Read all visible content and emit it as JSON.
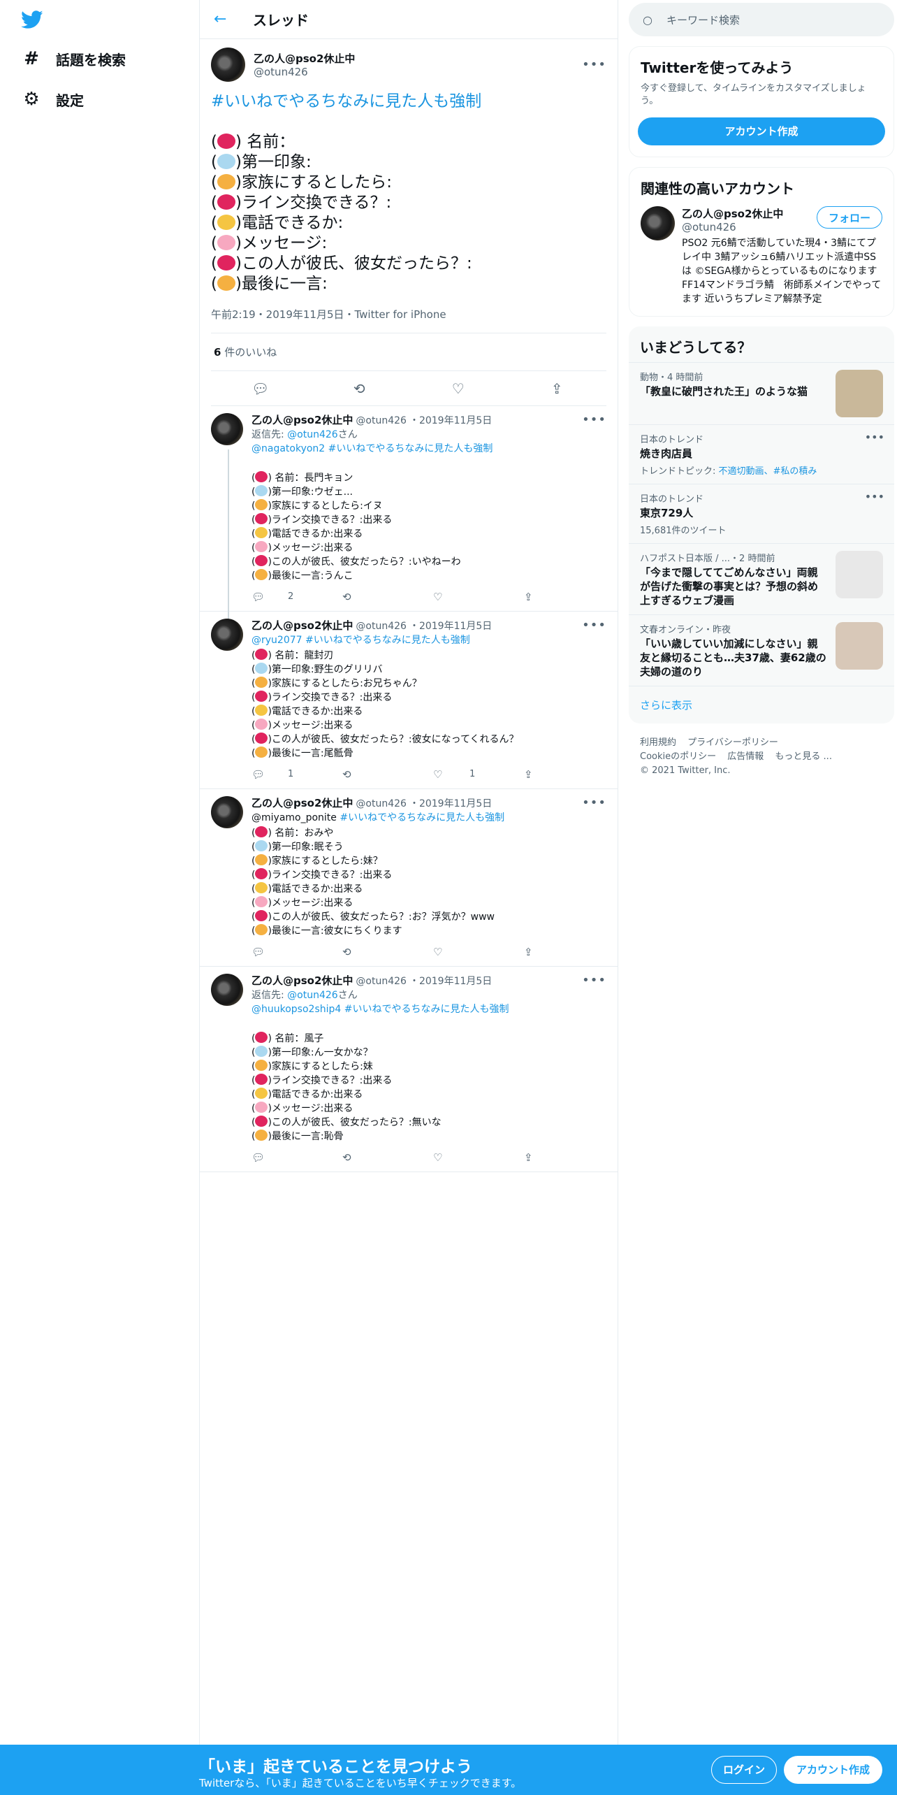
{
  "nav": {
    "items": [
      {
        "label": "話題を検索"
      },
      {
        "label": "設定"
      }
    ]
  },
  "header": {
    "title": "スレッド"
  },
  "main_tweet": {
    "name": "乙の人@pso2休止中",
    "handle": "@otun426",
    "hashtag": "#いいねでやるちなみに見た人も強制",
    "lines": [
      ") 名前：",
      ")第一印象:",
      ")家族にするとしたら:",
      ")ライン交換できる？:",
      ")電話できるか:",
      ")メッセージ:",
      ")この人が彼氏、彼女だったら？:",
      ")最後に一言:"
    ],
    "emoji_colors": [
      "#e0245e",
      "#aad8f0",
      "#f5b041",
      "#e0245e",
      "#f5c542",
      "#f7a8c0",
      "#e0245e",
      "#f5b041"
    ],
    "meta": "午前2:19・2019年11月5日・Twitter for iPhone",
    "likes_count": "6",
    "likes_label": "件のいいね"
  },
  "replies": [
    {
      "name": "乙の人@pso2休止中",
      "handle": "@otun426",
      "date": "2019年11月5日",
      "reply_to_prefix": "返信先: ",
      "reply_to": "@otun426",
      "reply_to_suffix": "さん",
      "mention": "@nagatokyon2",
      "hashtag": "#いいねでやるちなみに見た人も強制",
      "lines": [
        ") 名前：長門キョン",
        ")第一印象:ウゼェ...",
        ")家族にするとしたら:イヌ",
        ")ライン交換できる？:出来る",
        ")電話できるか:出来る",
        ")メッセージ:出来る",
        ")この人が彼氏、彼女だったら？:いやねーわ",
        ")最後に一言:うんこ"
      ],
      "reply_count": "2",
      "retweet_count": "",
      "like_count": ""
    },
    {
      "name": "乙の人@pso2休止中",
      "handle": "@otun426",
      "date": "2019年11月5日",
      "mention": "@ryu2077",
      "hashtag": "#いいねでやるちなみに見た人も強制",
      "lines": [
        ") 名前：龍封刃",
        ")第一印象:野生のグリリバ",
        ")家族にするとしたら:お兄ちゃん？",
        ")ライン交換できる？:出来る",
        ")電話できるか:出来る",
        ")メッセージ:出来る",
        ")この人が彼氏、彼女だったら？:彼女になってくれるん？",
        ")最後に一言:尾骶骨"
      ],
      "reply_count": "1",
      "retweet_count": "",
      "like_count": "1"
    },
    {
      "name": "乙の人@pso2休止中",
      "handle": "@otun426",
      "date": "2019年11月5日",
      "mention_plain": "@miyamo_ponite",
      "hashtag": "#いいねでやるちなみに見た人も強制",
      "lines": [
        ") 名前：おみや",
        ")第一印象:眠そう",
        ")家族にするとしたら:妹？",
        ")ライン交換できる？:出来る",
        ")電話できるか:出来る",
        ")メッセージ:出来る",
        ")この人が彼氏、彼女だったら？:お？浮気か？www",
        ")最後に一言:彼女にちくります"
      ],
      "reply_count": "",
      "retweet_count": "",
      "like_count": ""
    },
    {
      "name": "乙の人@pso2休止中",
      "handle": "@otun426",
      "date": "2019年11月5日",
      "reply_to_prefix": "返信先: ",
      "reply_to": "@otun426",
      "reply_to_suffix": "さん",
      "mention": "@huukopso2ship4",
      "hashtag": "#いいねでやるちなみに見た人も強制",
      "lines": [
        ") 名前：風子",
        ")第一印象:ん一女かな？",
        ")家族にするとしたら:妹",
        ")ライン交換できる？:出来る",
        ")電話できるか:出来る",
        ")メッセージ:出来る",
        ")この人が彼氏、彼女だったら？:無いな",
        ")最後に一言:恥骨"
      ],
      "reply_count": "",
      "retweet_count": "",
      "like_count": ""
    }
  ],
  "search": {
    "placeholder": "キーワード検索"
  },
  "signup_box": {
    "title": "Twitterを使ってみよう",
    "sub": "今すぐ登録して、タイムラインをカスタマイズしましょう。",
    "button": "アカウント作成"
  },
  "related": {
    "title": "関連性の高いアカウント",
    "name": "乙の人@pso2休止中",
    "handle": "@otun426",
    "follow": "フォロー",
    "bio": "PSO2 元6鯖で活動していた現4・3鯖にてプレイ中 3鯖アッシュ6鯖ハリエット派遣中SSは ©SEGA様からとっているものになります FF14マンドラゴラ鯖　術師系メインでやってます 近いうちプレミア解禁予定"
  },
  "trends": {
    "title": "いまどうしてる？",
    "items": [
      {
        "cat": "動物・4 時間前",
        "title": "「教皇に破門された王」のような猫",
        "sub": "",
        "thumb_color": "#c9b89a"
      },
      {
        "cat": "日本のトレンド",
        "title": "焼き肉店員",
        "sub_prefix": "トレンドトピック: ",
        "sub_links": "不適切動画、#私の積み",
        "thumb_color": ""
      },
      {
        "cat": "日本のトレンド",
        "title": "東京729人",
        "sub": "15,681件のツイート",
        "thumb_color": ""
      },
      {
        "cat": "ハフポスト日本版 / ...・2 時間前",
        "title": "「今まで隠しててごめんなさい」両親が告げた衝撃の事実とは？予想の斜め上すぎるウェブ漫画",
        "sub": "",
        "thumb_color": "#e8e8e8"
      },
      {
        "cat": "文春オンライン・昨夜",
        "title": "「いい歳していい加減にしなさい」親友と縁切ることも…夫37歳、妻62歳の夫婦の道のり",
        "sub": "",
        "thumb_color": "#d8c8b8"
      }
    ],
    "more": "さらに表示"
  },
  "footer": {
    "links": [
      "利用規約",
      "プライバシーポリシー",
      "Cookieのポリシー",
      "広告情報",
      "もっと見る ..."
    ],
    "copyright": "© 2021 Twitter, Inc."
  },
  "bottom_bar": {
    "title": "「いま」起きていることを見つけよう",
    "sub": "Twitterなら、「いま」起きていることをいち早くチェックできます。",
    "login": "ログイン",
    "signup": "アカウント作成"
  },
  "colors": {
    "accent": "#1da1f2",
    "link": "#1b95e0"
  }
}
